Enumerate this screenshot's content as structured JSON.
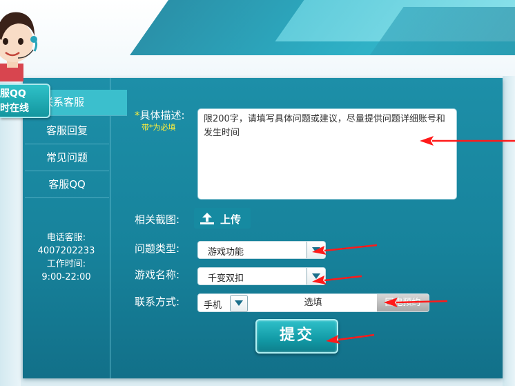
{
  "sidebar": {
    "items": [
      {
        "label": "联系客服"
      },
      {
        "label": "客服回复"
      },
      {
        "label": "常见问题"
      },
      {
        "label": "客服QQ"
      }
    ],
    "contact": {
      "phone_label": "电话客服:",
      "phone": "4007202233",
      "hours_label": "工作时间:",
      "hours": "9:00-22:00"
    }
  },
  "qq_badge": {
    "line1": "客服QQ",
    "line2": "小时在线"
  },
  "form": {
    "description": {
      "star": "*",
      "label": "具体描述:",
      "required_note": "带*为必填",
      "placeholder": "限200字，请填写具体问题或建议，尽量提供问题详细账号和发生时间"
    },
    "screenshot": {
      "label": "相关截图:",
      "upload_label": "上传"
    },
    "issue_type": {
      "label": "问题类型:",
      "value": "游戏功能"
    },
    "game_name": {
      "label": "游戏名称:",
      "value": "千变双扣"
    },
    "contact": {
      "label": "联系方式:",
      "type": "手机",
      "placeholder": "选填",
      "reserve_label": "回电预约"
    },
    "submit_label": "提交"
  },
  "colors": {
    "accent": "#1d8fa8",
    "required": "#ffef3b",
    "arrow": "#ff1a1a"
  }
}
